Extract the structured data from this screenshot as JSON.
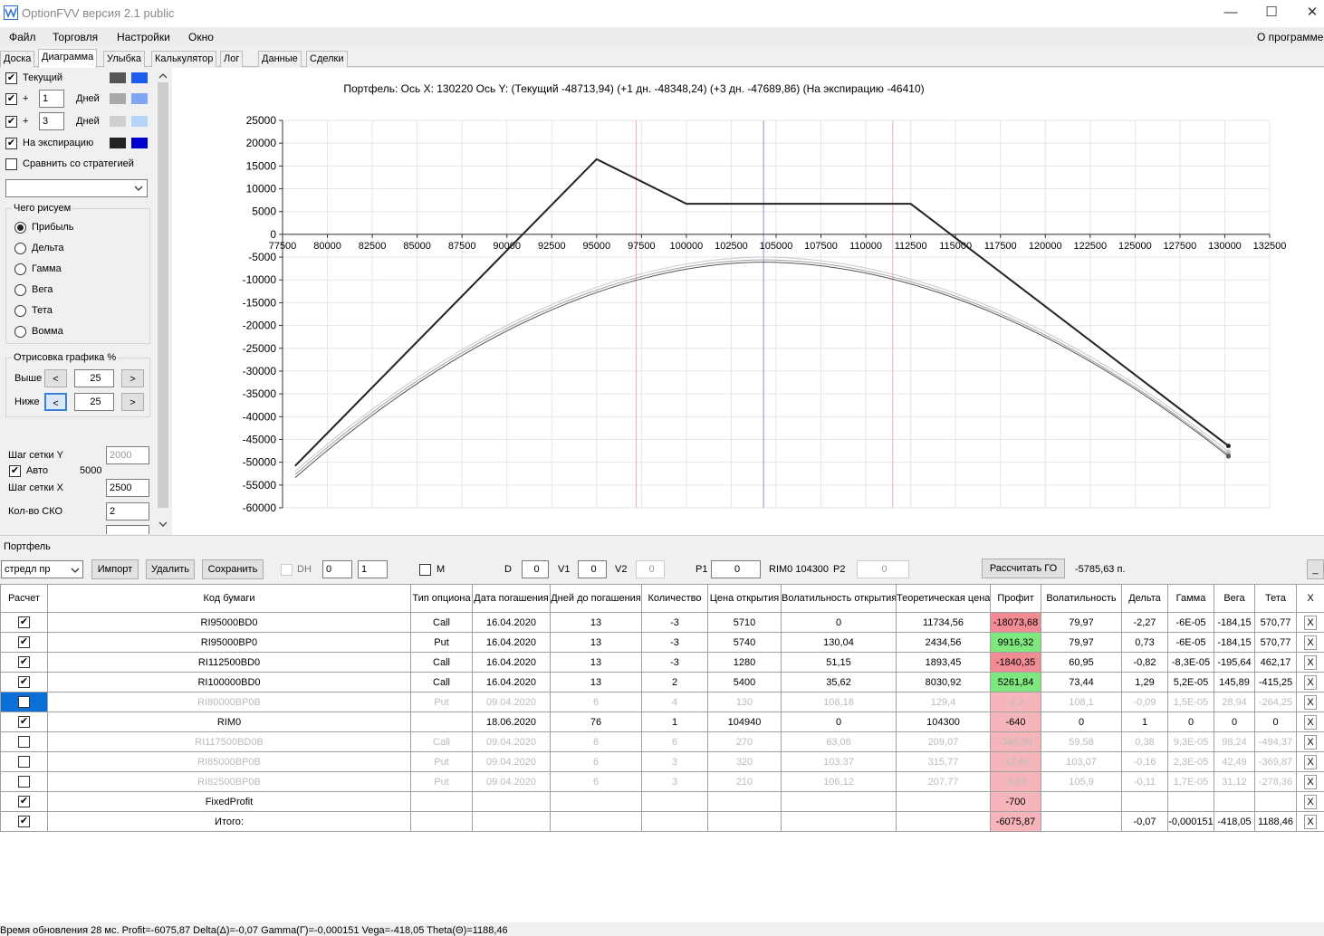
{
  "app": {
    "title": "OptionFVV версия 2.1 public",
    "minimize": "—",
    "maximize": "☐",
    "close": "✕"
  },
  "menu": {
    "file": "Файл",
    "trade": "Торговля",
    "settings": "Настройки",
    "window": "Окно",
    "about": "О программе"
  },
  "tabs": [
    "Доска",
    "Диаграмма",
    "Улыбка",
    "Калькулятор",
    "Лог",
    "Данные",
    "Сделки"
  ],
  "left": {
    "current": "Текущий",
    "plus": "+",
    "days": "Дней",
    "d1": "1",
    "d3": "3",
    "expiry": "На экспирацию",
    "compare": "Сравнить со стратегией",
    "what_title": "Чего рисуем",
    "radios": [
      "Прибыль",
      "Дельта",
      "Гамма",
      "Вега",
      "Тета",
      "Вомма"
    ],
    "draw_title": "Отрисовка графика %",
    "above": "Выше",
    "below": "Ниже",
    "lt": "<",
    "gt": ">",
    "above_v": "25",
    "below_v": "25",
    "gridy_lbl": "Шаг сетки Y",
    "gridy_v": "2000",
    "auto": "Авто",
    "auto_v": "5000",
    "gridx_lbl": "Шаг сетки X",
    "gridx_v": "2500",
    "sko_lbl": "Кол-во СКО",
    "sko_v": "2",
    "sw": {
      "current": [
        "#555555",
        "#1e5cf0"
      ],
      "d1": [
        "#a9a9a9",
        "#7ea6f2"
      ],
      "d3": [
        "#cfcfcf",
        "#b4d4f7"
      ],
      "expiry": [
        "#222222",
        "#0000cc"
      ]
    }
  },
  "chart_data": {
    "type": "line",
    "title": "Портфель: Ось X: 130220 Ось Y: (Текущий -48713,94) (+1 дн. -48348,24) (+3 дн. -47689,86) (На экспирацию -46410)",
    "xlim": [
      77500,
      132500
    ],
    "ylim": [
      -60000,
      25000
    ],
    "xticks": [
      77500,
      80000,
      82500,
      85000,
      87500,
      90000,
      92500,
      95000,
      97500,
      100000,
      102500,
      105000,
      107500,
      110000,
      112500,
      115000,
      117500,
      120000,
      122500,
      125000,
      127500,
      130000,
      132500
    ],
    "yticks": [
      25000,
      20000,
      15000,
      10000,
      5000,
      0,
      -5000,
      -10000,
      -15000,
      -20000,
      -25000,
      -30000,
      -35000,
      -40000,
      -45000,
      -50000,
      -55000,
      -60000
    ],
    "vlines": [
      {
        "x": 97200,
        "color": "#f4a6b2"
      },
      {
        "x": 104300,
        "color": "#8c8cc8"
      },
      {
        "x": 111500,
        "color": "#f4a6b2"
      }
    ],
    "series": [
      {
        "color": "#222222",
        "width": 2,
        "points": [
          [
            78200,
            -50800
          ],
          [
            95000,
            16500
          ],
          [
            100000,
            6700
          ],
          [
            112500,
            6700
          ],
          [
            130200,
            -46410
          ]
        ]
      },
      {
        "color": "#c8c8c8",
        "width": 1,
        "curve": {
          "peak_x": 104300,
          "peak_y": -5000,
          "x0": 78200,
          "y0": -52000,
          "x1": 130200,
          "y1": -47690
        }
      },
      {
        "color": "#a0a0a0",
        "width": 1,
        "curve": {
          "peak_x": 104300,
          "peak_y": -5600,
          "x0": 78200,
          "y0": -52700,
          "x1": 130200,
          "y1": -48348
        }
      },
      {
        "color": "#555555",
        "width": 1,
        "curve": {
          "peak_x": 104300,
          "peak_y": -6100,
          "x0": 78200,
          "y0": -53400,
          "x1": 130200,
          "y1": -48714
        }
      }
    ]
  },
  "portfolio": {
    "label": "Портфель",
    "select": "стредл пр",
    "import": "Импорт",
    "delete": "Удалить",
    "save": "Сохранить",
    "dh": "DH",
    "dh1": "0",
    "dh2": "1",
    "m": "M",
    "d": "D",
    "d_v": "0",
    "v1": "V1",
    "v1_v": "0",
    "v2": "V2",
    "v2_v": "0",
    "p1": "P1",
    "p1_v": "0",
    "rim": "RIM0 104300",
    "p2": "P2",
    "p2_v": "0",
    "go": "Рассчитать ГО",
    "go_v": "-5785,63 п.",
    "min": "_"
  },
  "table": {
    "headers": [
      "Расчет",
      "Код бумаги",
      "Тип опциона",
      "Дата погашения",
      "Дней до погашения",
      "Количество",
      "Цена открытия",
      "Волатильность открытия",
      "Теоретическая цена",
      "Профит",
      "Волатильность",
      "Дельта",
      "Гамма",
      "Вега",
      "Тета",
      "X"
    ],
    "rows": [
      {
        "ck": "✔",
        "active": true,
        "cells": [
          "RI95000BD0",
          "Call",
          "16.04.2020",
          "13",
          "-3",
          "5710",
          "0",
          "11734,56",
          "-18073,68",
          "79,97",
          "-2,27",
          "-6E-05",
          "-184,15",
          "570,77"
        ],
        "pc": "#f28c94"
      },
      {
        "ck": "✔",
        "active": true,
        "cells": [
          "RI95000BP0",
          "Put",
          "16.04.2020",
          "13",
          "-3",
          "5740",
          "130,04",
          "2434,56",
          "9916,32",
          "79,97",
          "0,73",
          "-6E-05",
          "-184,15",
          "570,77"
        ],
        "pc": "#7ee87e"
      },
      {
        "ck": "✔",
        "active": true,
        "cells": [
          "RI112500BD0",
          "Call",
          "16.04.2020",
          "13",
          "-3",
          "1280",
          "51,15",
          "1893,45",
          "-1840,35",
          "60,95",
          "-0,82",
          "-8,3E-05",
          "-195,64",
          "462,17"
        ],
        "pc": "#f28c94"
      },
      {
        "ck": "✔",
        "active": true,
        "cells": [
          "RI100000BD0",
          "Call",
          "16.04.2020",
          "13",
          "2",
          "5400",
          "35,62",
          "8030,92",
          "5261,84",
          "73,44",
          "1,29",
          "5,2E-05",
          "145,89",
          "-415,25"
        ],
        "pc": "#7ee87e"
      },
      {
        "ck": "",
        "active": false,
        "sel": true,
        "cells": [
          "RI80000BP0B",
          "Put",
          "09.04.2020",
          "6",
          "4",
          "130",
          "108,18",
          "129,4",
          "-2,2",
          "108,1",
          "-0,09",
          "1,5E-05",
          "28,94",
          "-264,25"
        ],
        "pc": "#f5b5bb"
      },
      {
        "ck": "✔",
        "active": true,
        "cells": [
          "RIM0",
          "",
          "18.06.2020",
          "76",
          "1",
          "104940",
          "0",
          "104300",
          "-640",
          "0",
          "1",
          "0",
          "0",
          "0"
        ],
        "pc": "#f5b5bb"
      },
      {
        "ck": "",
        "active": false,
        "cells": [
          "RI117500BD0B",
          "Call",
          "09.04.2020",
          "6",
          "6",
          "270",
          "63,06",
          "209,07",
          "-368,58",
          "59,58",
          "0,38",
          "9,3E-05",
          "98,24",
          "-494,37"
        ],
        "pc": "#f5b5bb"
      },
      {
        "ck": "",
        "active": false,
        "cells": [
          "RI85000BP0B",
          "Put",
          "09.04.2020",
          "6",
          "3",
          "320",
          "103,37",
          "315,77",
          "-12,69",
          "103,07",
          "-0,16",
          "2,3E-05",
          "42,49",
          "-369,87"
        ],
        "pc": "#f5b5bb"
      },
      {
        "ck": "",
        "active": false,
        "cells": [
          "RI82500BP0B",
          "Put",
          "09.04.2020",
          "6",
          "3",
          "210",
          "106,12",
          "207,77",
          "-6,69",
          "105,9",
          "-0,11",
          "1,7E-05",
          "31,12",
          "-278,36"
        ],
        "pc": "#f5b5bb"
      },
      {
        "ck": "✔",
        "active": true,
        "cells": [
          "FixedProfit",
          "",
          "",
          "",
          "",
          "",
          "",
          "",
          "-700",
          "",
          "",
          "",
          "",
          ""
        ],
        "pc": "#f5b5bb"
      },
      {
        "ck": "✔",
        "active": true,
        "cells": [
          "Итого:",
          "",
          "",
          "",
          "",
          "",
          "",
          "",
          "-6075,87",
          "",
          "-0,07",
          "-0,000151",
          "-418,05",
          "1188,46"
        ],
        "pc": "#f5b5bb"
      }
    ],
    "xlabel": "X"
  },
  "status": "Время обновления 28 мс. Profit=-6075,87 Delta(Δ)=-0,07 Gamma(Γ)=-0,000151 Vega=-418,05 Theta(Θ)=1188,46"
}
